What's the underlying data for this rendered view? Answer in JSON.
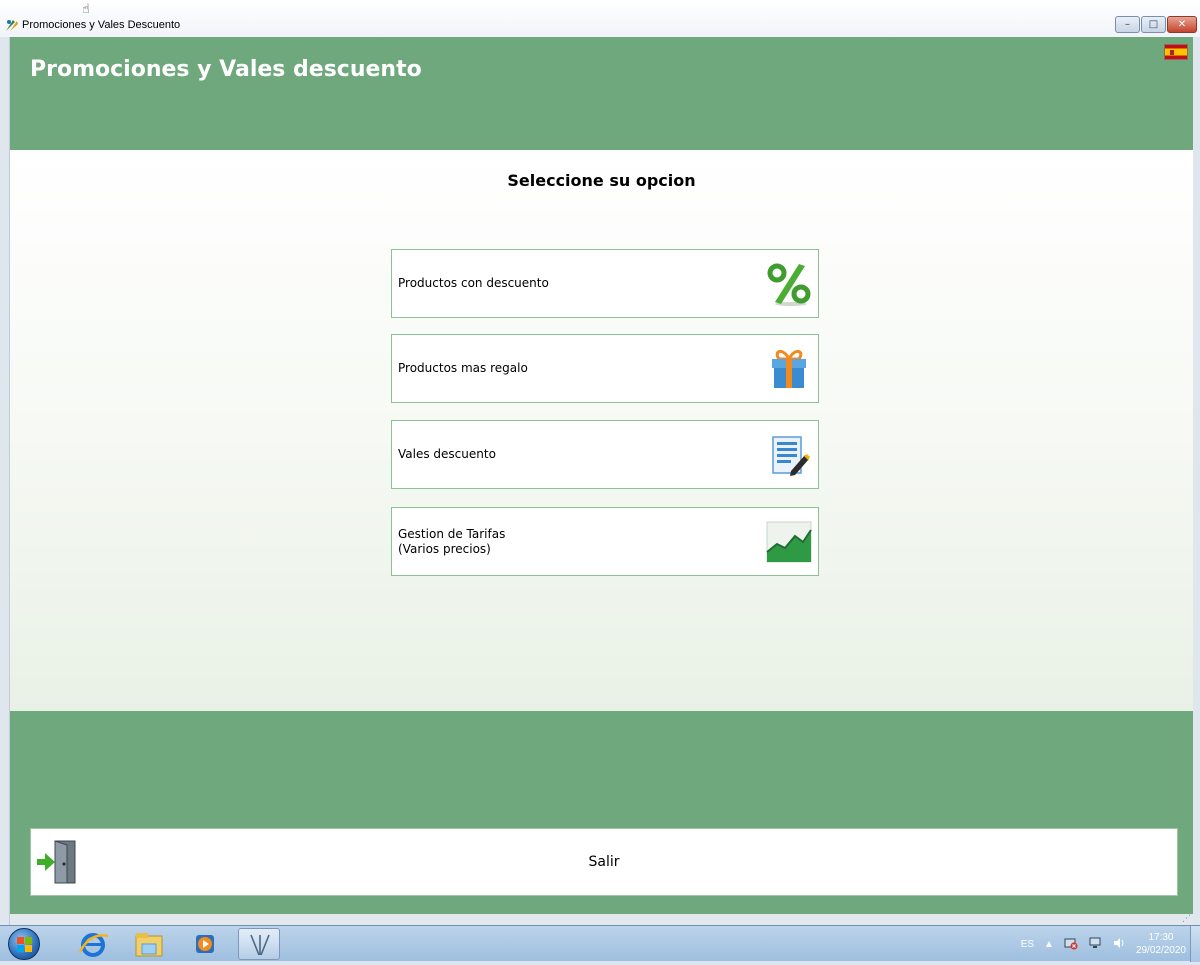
{
  "window": {
    "title": "Promociones y Vales Descuento",
    "cursor": "☝",
    "controls": {
      "minimize": "–",
      "maximize": "□",
      "close": "✕"
    }
  },
  "header": {
    "title": "Promociones y Vales descuento",
    "flag_icon": "spain-flag-icon",
    "color": "#6fa87c"
  },
  "main": {
    "prompt": "Seleccione su opcion",
    "options": [
      {
        "label": "Productos con descuento",
        "icon": "percent-icon"
      },
      {
        "label": "Productos mas regalo",
        "icon": "gift-icon"
      },
      {
        "label": "Vales descuento",
        "icon": "voucher-edit-icon"
      },
      {
        "label_lines": [
          "Gestion de Tarifas",
          "(Varios precios)"
        ],
        "icon": "price-chart-icon"
      }
    ]
  },
  "footer": {
    "exit_label": "Salir",
    "exit_icon": "exit-door-icon",
    "color": "#6fa87c"
  },
  "taskbar": {
    "apps": [
      "start-orb-icon",
      "internet-explorer-icon",
      "file-explorer-icon",
      "media-player-icon",
      "promo-app-icon"
    ],
    "language": "ES",
    "time": "17:30",
    "date": "29/02/2020"
  }
}
